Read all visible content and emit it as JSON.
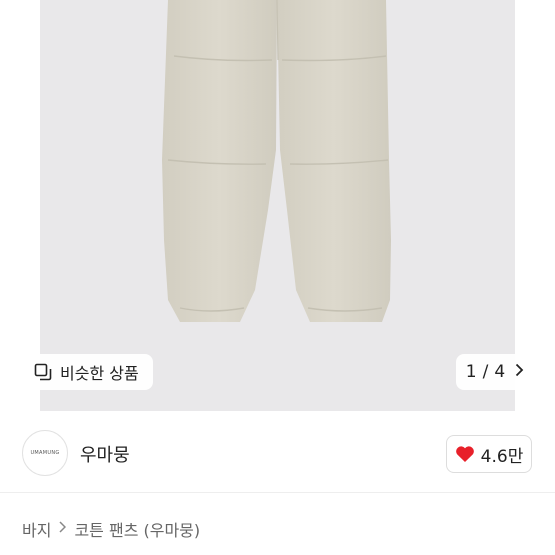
{
  "gallery": {
    "similar_label": "비슷한 상품",
    "pager": {
      "current": "1",
      "separator": "/",
      "total": "4"
    }
  },
  "seller": {
    "avatar_text": "UMAMUNG",
    "name": "우마뭉",
    "likes": "4.6만"
  },
  "breadcrumb": {
    "category": "바지",
    "item": "코튼 팬츠 (우마뭉)"
  },
  "colors": {
    "like_heart": "#e8202a",
    "photo_bg": "#e9e8ea",
    "pants": "#d8d4c7"
  }
}
